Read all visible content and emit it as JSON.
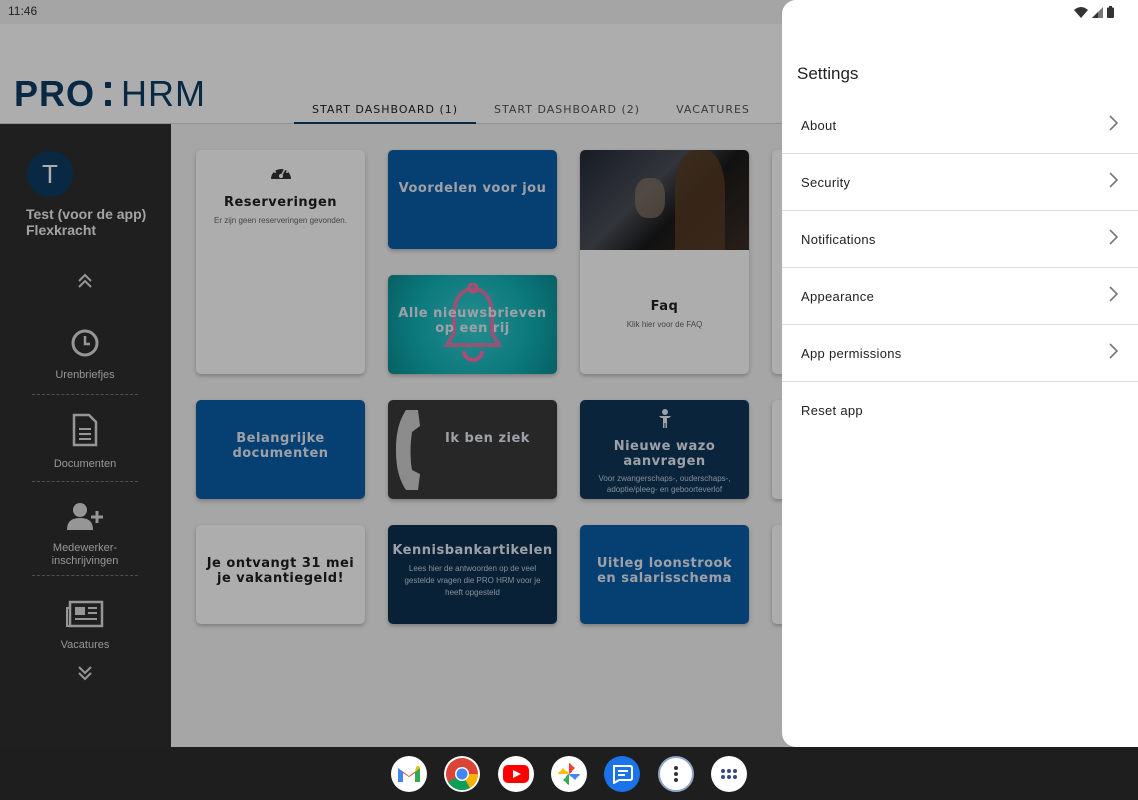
{
  "status_bar": {
    "time": "11:46"
  },
  "app": {
    "logo": {
      "left": "PRO",
      "right": "HRM"
    },
    "tabs": [
      {
        "label": "START DASHBOARD (1)",
        "active": true
      },
      {
        "label": "START DASHBOARD (2)",
        "active": false
      },
      {
        "label": "VACATURES",
        "active": false
      }
    ],
    "sidebar": {
      "avatar_letter": "T",
      "user_name": "Test (voor de app) Flexkracht",
      "items": [
        {
          "label": "Urenbriefjes",
          "icon": "clock-icon"
        },
        {
          "label": "Documenten",
          "icon": "document-icon"
        },
        {
          "label": "Medewerker-\ninschrijvingen",
          "icon": "add-user-icon"
        },
        {
          "label": "Vacatures",
          "icon": "newspaper-icon"
        }
      ]
    },
    "tiles": {
      "reserveringen": {
        "title": "Reserveringen",
        "subtitle": "Er zijn geen reserveringen gevonden."
      },
      "voordelen": {
        "title": "Voordelen voor jou"
      },
      "nieuwsbrieven": {
        "title": "Alle nieuwsbrieven op een rij"
      },
      "faq": {
        "title": "Faq",
        "subtitle": "Klik hier voor de FAQ"
      },
      "documenten": {
        "title": "Belangrijke documenten"
      },
      "ziek": {
        "title": "Ik ben ziek"
      },
      "wazo": {
        "title": "Nieuwe wazo aanvragen",
        "subtitle": "Voor zwangerschaps-, ouderschaps-, adoptie/pleeg- en geboorteverlof"
      },
      "vakantiegeld": {
        "title": "Je ontvangt 31 mei je vakantiegeld!"
      },
      "kennisbank": {
        "title": "Kennisbankartikelen",
        "subtitle": "Lees hier de antwoorden op de veel gestelde vragen die PRO HRM voor je heeft opgesteld"
      },
      "loonstrook": {
        "title": "Uitleg loonstrook en salarisschema"
      }
    },
    "colors": {
      "brand_navy": "#0d3b63",
      "tile_blue": "#0a5da8",
      "tile_navy": "#0f3558",
      "tile_teal": "#11b2b8"
    }
  },
  "settings": {
    "title": "Settings",
    "items": [
      {
        "label": "About",
        "chevron": true
      },
      {
        "label": "Security",
        "chevron": true
      },
      {
        "label": "Notifications",
        "chevron": true
      },
      {
        "label": "Appearance",
        "chevron": true
      },
      {
        "label": "App permissions",
        "chevron": true
      },
      {
        "label": "Reset app",
        "chevron": false
      }
    ]
  },
  "dock": {
    "apps": [
      "gmail-icon",
      "chrome-icon",
      "youtube-icon",
      "photos-icon",
      "messages-icon",
      "more-options-icon",
      "app-drawer-icon"
    ]
  }
}
